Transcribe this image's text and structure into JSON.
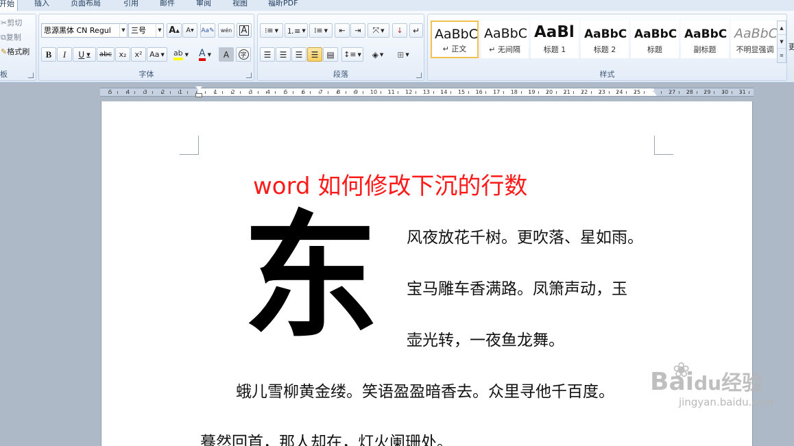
{
  "tabs": [
    "开始",
    "插入",
    "页面布局",
    "引用",
    "邮件",
    "审阅",
    "视图",
    "福昕PDF"
  ],
  "clipboard": {
    "cut": "剪切",
    "copy": "复制",
    "format_painter": "格式刷",
    "group_label": "板"
  },
  "font": {
    "name": "思源黑体 CN Regul",
    "size": "三号",
    "grow_label": "A",
    "shrink_label": "A",
    "wen_label": "wén",
    "bold": "B",
    "italic": "I",
    "underline": "U",
    "strike": "abc",
    "subscript": "x₂",
    "superscript": "x²",
    "case": "Aa",
    "highlight": "ab",
    "color": "A",
    "shade": "A",
    "enclose": "字",
    "group_label": "字体"
  },
  "paragraph": {
    "group_label": "段落"
  },
  "styles": {
    "group_label": "样式",
    "items": [
      {
        "sample": "AaBbC",
        "name": "↵ 正文"
      },
      {
        "sample": "AaBbC",
        "name": "↵ 无间隔"
      },
      {
        "sample": "AaBl",
        "name": "标题 1"
      },
      {
        "sample": "AaBbC",
        "name": "标题 2"
      },
      {
        "sample": "AaBbC",
        "name": "标题"
      },
      {
        "sample": "AaBbC",
        "name": "副标题"
      },
      {
        "sample": "AaBbC",
        "name": "不明显强调"
      }
    ],
    "extra": "更"
  },
  "ruler": {
    "left_numbers": [
      "5",
      "4",
      "3",
      "2",
      "1"
    ],
    "right_numbers": [
      "1",
      "2",
      "3",
      "4",
      "5",
      "6",
      "7",
      "8",
      "9",
      "10",
      "11",
      "12",
      "13",
      "14",
      "15",
      "16",
      "17",
      "18",
      "19",
      "20",
      "21",
      "22",
      "23",
      "24",
      "25",
      "",
      "27",
      "28",
      "29",
      "30",
      "31"
    ]
  },
  "document": {
    "title": "word 如何修改下沉的行数",
    "dropcap": "东",
    "lines": [
      "风夜放花千树。更吹落、星如雨。",
      "宝马雕车香满路。凤箫声动，玉",
      "壶光转，一夜鱼龙舞。",
      "蛾儿雪柳黄金缕。笑语盈盈暗香去。众里寻他千百度。",
      "蓦然回首，那人却在，灯火阑珊处。"
    ]
  },
  "watermark": {
    "logo": "Bai",
    "logo2": "du",
    "brand": "经验",
    "site": "jingyan.baidu.com"
  }
}
